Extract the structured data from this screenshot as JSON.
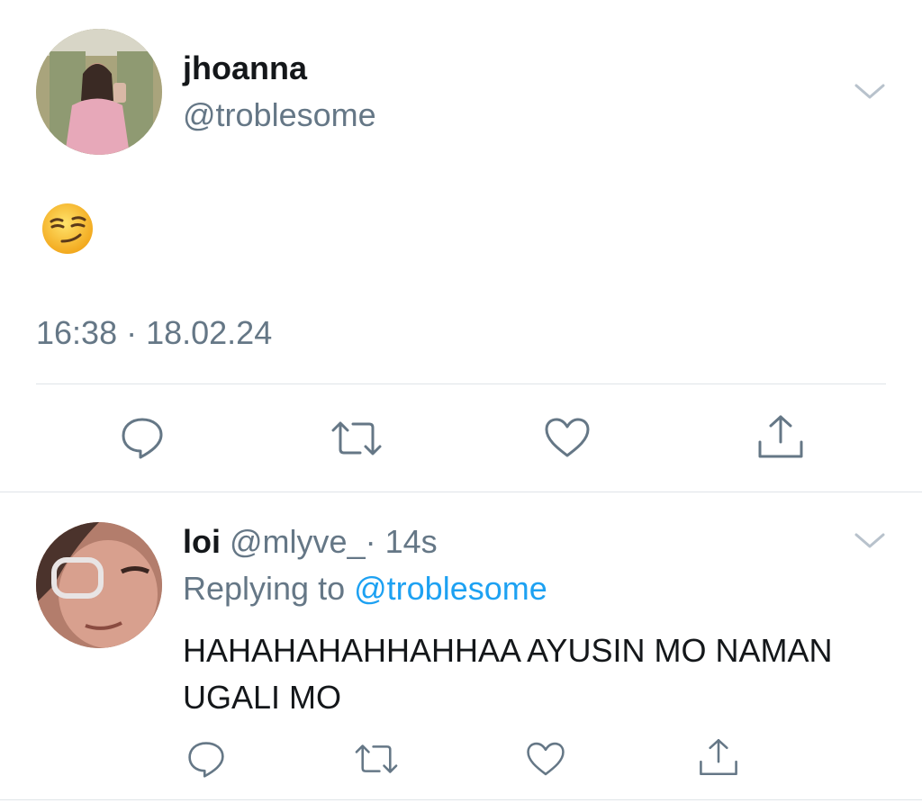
{
  "tweet": {
    "display_name": "jhoanna",
    "handle": "@troblesome",
    "content_emoji": "smirking-face",
    "timestamp": "16:38 · 18.02.24",
    "actions": [
      "reply-icon",
      "retweet-icon",
      "like-icon",
      "share-icon"
    ]
  },
  "reply": {
    "display_name": "loi",
    "handle": "@mlyve_",
    "time": "· 14s",
    "replying_prefix": "Replying to",
    "replying_handle": "@troblesome",
    "text": "HAHAHAHAHHAHHAA AYUSIN MO NAMAN UGALI MO",
    "actions": [
      "reply-icon",
      "retweet-icon",
      "like-icon",
      "share-icon"
    ]
  },
  "colors": {
    "text": "#14171a",
    "secondary": "#657786",
    "link": "#1da1f2",
    "divider": "#dfe4e8"
  }
}
